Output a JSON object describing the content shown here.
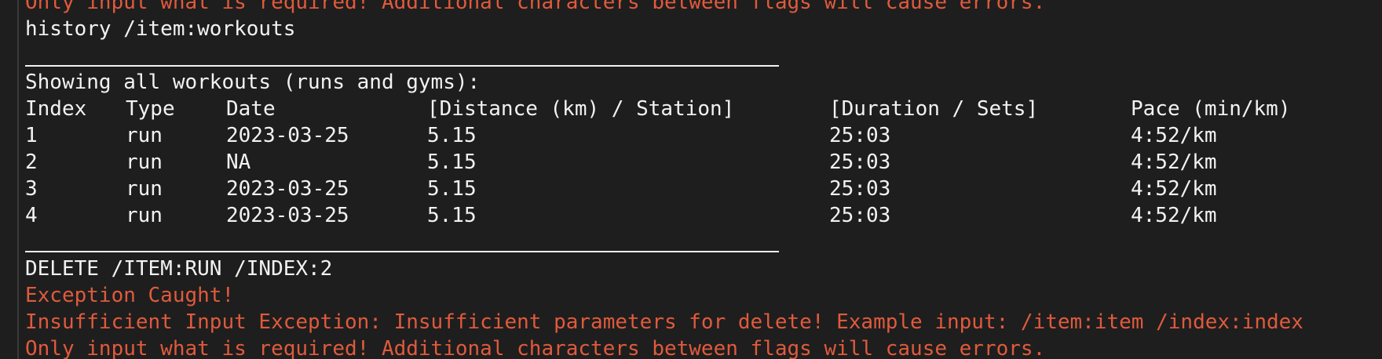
{
  "terminal": {
    "lines_top": {
      "error_cut": "Only input what is required! Additional characters between flags will cause errors.",
      "command_history": "history /item:workouts"
    },
    "table_intro": "Showing all workouts (runs and gyms):",
    "table": {
      "headers": [
        "Index",
        "Type",
        "Date",
        "[Distance (km) / Station]",
        "[Duration / Sets]",
        "Pace (min/km)"
      ],
      "rows": [
        [
          "1",
          "run",
          "2023-03-25",
          "5.15",
          "25:03",
          "4:52/km"
        ],
        [
          "2",
          "run",
          "NA",
          "5.15",
          "25:03",
          "4:52/km"
        ],
        [
          "3",
          "run",
          "2023-03-25",
          "5.15",
          "25:03",
          "4:52/km"
        ],
        [
          "4",
          "run",
          "2023-03-25",
          "5.15",
          "25:03",
          "4:52/km"
        ]
      ]
    },
    "lines_bottom": {
      "command_delete": "DELETE /ITEM:RUN /INDEX:2",
      "exception_caught": "Exception Caught!",
      "exception_detail": "Insufficient Input Exception: Insufficient parameters for delete! Example input: /item:item /index:index",
      "error_tail": "Only input what is required! Additional characters between flags will cause errors."
    }
  },
  "colors": {
    "background": "#1e1e1e",
    "text": "#f2f2f2",
    "error": "#e05a3c"
  }
}
